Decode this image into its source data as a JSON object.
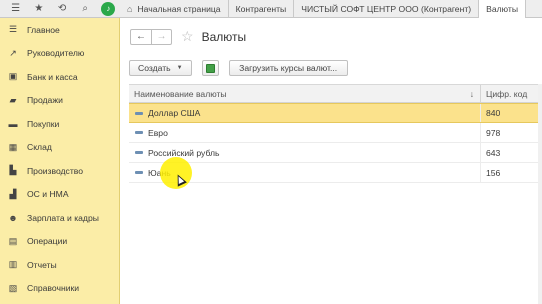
{
  "topbar": {
    "icons": [
      "menu-icon",
      "star-icon",
      "history-icon",
      "search-icon",
      "bell-icon"
    ],
    "tabs": [
      {
        "label": "Начальная страница",
        "active": false
      },
      {
        "label": "Контрагенты",
        "active": false
      },
      {
        "label": "ЧИСТЫЙ СОФТ ЦЕНТР ООО (Контрагент)",
        "active": false
      },
      {
        "label": "Валюты",
        "active": true
      }
    ]
  },
  "sidebar": {
    "items": [
      {
        "label": "Главное",
        "icon": "menu-icon"
      },
      {
        "label": "Руководителю",
        "icon": "chart-icon"
      },
      {
        "label": "Банк и касса",
        "icon": "bank-icon"
      },
      {
        "label": "Продажи",
        "icon": "bag-icon"
      },
      {
        "label": "Покупки",
        "icon": "cart-icon"
      },
      {
        "label": "Склад",
        "icon": "warehouse-icon"
      },
      {
        "label": "Производство",
        "icon": "factory-icon"
      },
      {
        "label": "ОС и НМА",
        "icon": "truck-icon"
      },
      {
        "label": "Зарплата и кадры",
        "icon": "person-icon"
      },
      {
        "label": "Операции",
        "icon": "gear-icon"
      },
      {
        "label": "Отчеты",
        "icon": "report-icon"
      },
      {
        "label": "Справочники",
        "icon": "book-icon"
      }
    ]
  },
  "main": {
    "title": "Валюты",
    "nav": {
      "back": "←",
      "forward": "→"
    },
    "toolbar": {
      "create_label": "Создать",
      "load_label": "Загрузить курсы валют..."
    },
    "table": {
      "columns": [
        "Наименование валюты",
        "Цифр. код"
      ],
      "rows": [
        {
          "name": "Доллар США",
          "code": "840",
          "selected": true
        },
        {
          "name": "Евро",
          "code": "978",
          "selected": false
        },
        {
          "name": "Российский рубль",
          "code": "643",
          "selected": false
        },
        {
          "name": "Юань",
          "code": "156",
          "selected": false
        }
      ]
    }
  },
  "colors": {
    "sidebar_bg": "#fbeda7",
    "selected_row": "#fbe28c",
    "accent_green": "#2aa84a"
  }
}
